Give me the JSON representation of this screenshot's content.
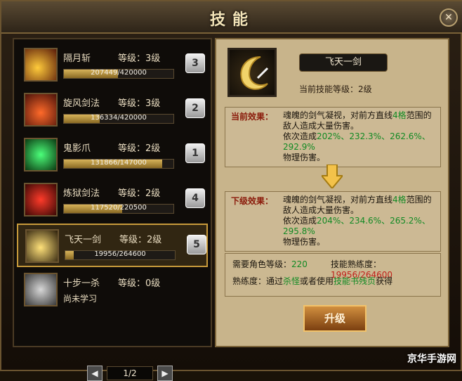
{
  "window": {
    "title": "技能",
    "close_label": "✕"
  },
  "skills": [
    {
      "name": "隔月斩",
      "level_text": "等级：3级",
      "exp": "207449/420000",
      "progress": 0.494,
      "hotkey": "3",
      "icon": "moon-slash-icon"
    },
    {
      "name": "旋风剑法",
      "level_text": "等级：3级",
      "exp": "136334/420000",
      "progress": 0.325,
      "hotkey": "2",
      "icon": "whirlwind-icon"
    },
    {
      "name": "鬼影爪",
      "level_text": "等级：2级",
      "exp": "131866/147000",
      "progress": 0.897,
      "hotkey": "1",
      "icon": "ghost-claw-icon"
    },
    {
      "name": "炼狱剑法",
      "level_text": "等级：2级",
      "exp": "117520/220500",
      "progress": 0.533,
      "hotkey": "4",
      "icon": "inferno-blade-icon"
    },
    {
      "name": "飞天一剑",
      "level_text": "等级：2级",
      "exp": "19956/264600",
      "progress": 0.075,
      "hotkey": "5",
      "icon": "flying-sword-icon"
    },
    {
      "name": "十步一杀",
      "level_text": "等级：0级",
      "unlearned_text": "尚未学习",
      "icon": "shadow-step-icon"
    }
  ],
  "pager": {
    "text": "1/2",
    "prev": "◀",
    "next": "▶"
  },
  "detail": {
    "name": "飞天一剑",
    "current_level": "当前技能等级：2级",
    "current_effect": {
      "tag": "当前效果：",
      "text1": "魂魄的剑气凝视，对前方直线",
      "highlight": "4格",
      "text2": "范围的敌人造成大量伤害。",
      "line3": "依次造成",
      "rates": "202%、232.3%、262.6%、292.9%",
      "line4": "物理伤害。"
    },
    "next_effect": {
      "tag": "下级效果：",
      "text1": "魂魄的剑气凝视，对前方直线",
      "highlight": "4格",
      "text2": "范围的敌人造成大量伤害。",
      "line3": "依次造成",
      "rates": "204%、234.6%、265.2%、295.8%",
      "line4": "物理伤害。"
    },
    "requirements": {
      "role_level_label": "需要角色等级：",
      "role_level_value": "220",
      "proficiency_label": "技能熟练度：",
      "proficiency_value": "19956/264600",
      "hint_part1": "熟练度：通过",
      "hint_highlight1": "杀怪",
      "hint_part2": "或者使用",
      "hint_highlight2": "技能书残页",
      "hint_part3": "获得"
    },
    "upgrade_label": "升级"
  },
  "watermark": "京华手游网",
  "colors": {
    "accent_gold": "#c79a3b",
    "exp_fill": "#d7b35a",
    "green_text": "#128a24",
    "red_value": "#c0201a"
  }
}
